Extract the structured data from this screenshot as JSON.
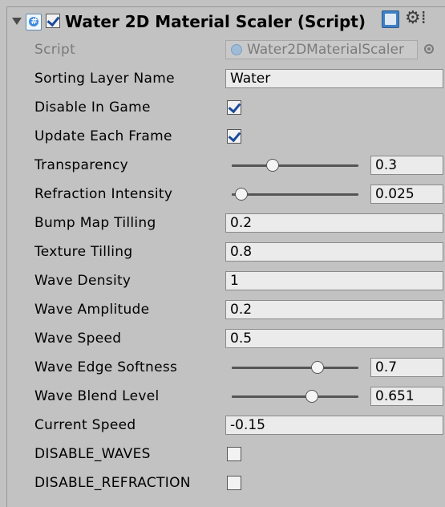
{
  "component": {
    "title": "Water 2D Material Scaler (Script)",
    "enabled": true,
    "icons": {
      "foldout": "foldout-expanded-icon",
      "script": "csharp-script-icon",
      "help": "help-icon",
      "settings": "gear-icon"
    }
  },
  "script": {
    "label": "Script",
    "value": "Water2DMaterialScaler"
  },
  "sorting_layer": {
    "label": "Sorting Layer Name",
    "value": "Water"
  },
  "disable_in_game": {
    "label": "Disable In Game",
    "checked": true
  },
  "update_each_frame": {
    "label": "Update Each Frame",
    "checked": true
  },
  "transparency": {
    "label": "Transparency",
    "value": "0.3",
    "fraction": 0.3
  },
  "refraction_intensity": {
    "label": "Refraction Intensity",
    "value": "0.025",
    "fraction": 0.025
  },
  "bump_map_tilling": {
    "label": "Bump Map Tilling",
    "value": "0.2"
  },
  "texture_tilling": {
    "label": "Texture Tilling",
    "value": "0.8"
  },
  "wave_density": {
    "label": "Wave Density",
    "value": "1"
  },
  "wave_amplitude": {
    "label": "Wave Amplitude",
    "value": "0.2"
  },
  "wave_speed": {
    "label": "Wave Speed",
    "value": "0.5"
  },
  "wave_edge_softness": {
    "label": "Wave Edge Softness",
    "value": "0.7",
    "fraction": 0.7
  },
  "wave_blend_level": {
    "label": "Wave Blend Level",
    "value": "0.651",
    "fraction": 0.651
  },
  "current_speed": {
    "label": "Current Speed",
    "value": "-0.15"
  },
  "disable_waves": {
    "label": "DISABLE_WAVES",
    "checked": false
  },
  "disable_refraction": {
    "label": "DISABLE_REFRACTION",
    "checked": false
  }
}
